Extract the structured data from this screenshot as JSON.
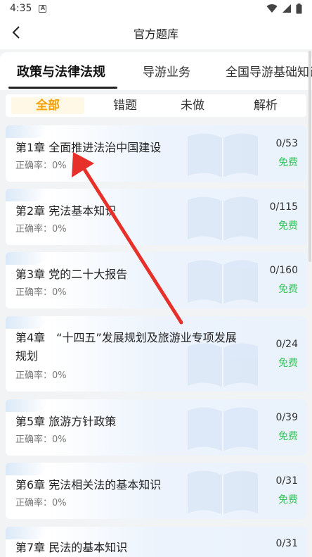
{
  "status_bar": {
    "time": "4:35",
    "sim_label": "A"
  },
  "navbar": {
    "title": "官方题库"
  },
  "tabs": [
    "政策与法律法规",
    "导游业务",
    "全国导游基础知识"
  ],
  "filters": [
    "全部",
    "错题",
    "未做",
    "解析"
  ],
  "chapters": [
    {
      "title": "第1章 全面推进法治中国建设",
      "accuracy": "正确率：0%",
      "progress": "0/53",
      "badge": "免费"
    },
    {
      "title": "第2章 宪法基本知识",
      "accuracy": "正确率：0%",
      "progress": "0/115",
      "badge": "免费"
    },
    {
      "title": "第3章 党的二十大报告",
      "accuracy": "正确率：0%",
      "progress": "0/160",
      "badge": "免费"
    },
    {
      "title": "第4章　“十四五”发展规划及旅游业专项发展",
      "title_line2": "规划",
      "accuracy": "正确率：0%",
      "progress": "0/24",
      "badge": "免费"
    },
    {
      "title": "第5章 旅游方针政策",
      "accuracy": "正确率：0%",
      "progress": "0/39",
      "badge": "免费"
    },
    {
      "title": "第6章 宪法相关法的基本知识",
      "accuracy": "正确率：0%",
      "progress": "0/31",
      "badge": "免费"
    },
    {
      "title": "第7章 民法的基本知识",
      "progress": "0/31"
    }
  ],
  "colors": {
    "accent_orange": "#f5a000",
    "free_green": "#35c25a",
    "annotation_red": "#e8302a"
  }
}
